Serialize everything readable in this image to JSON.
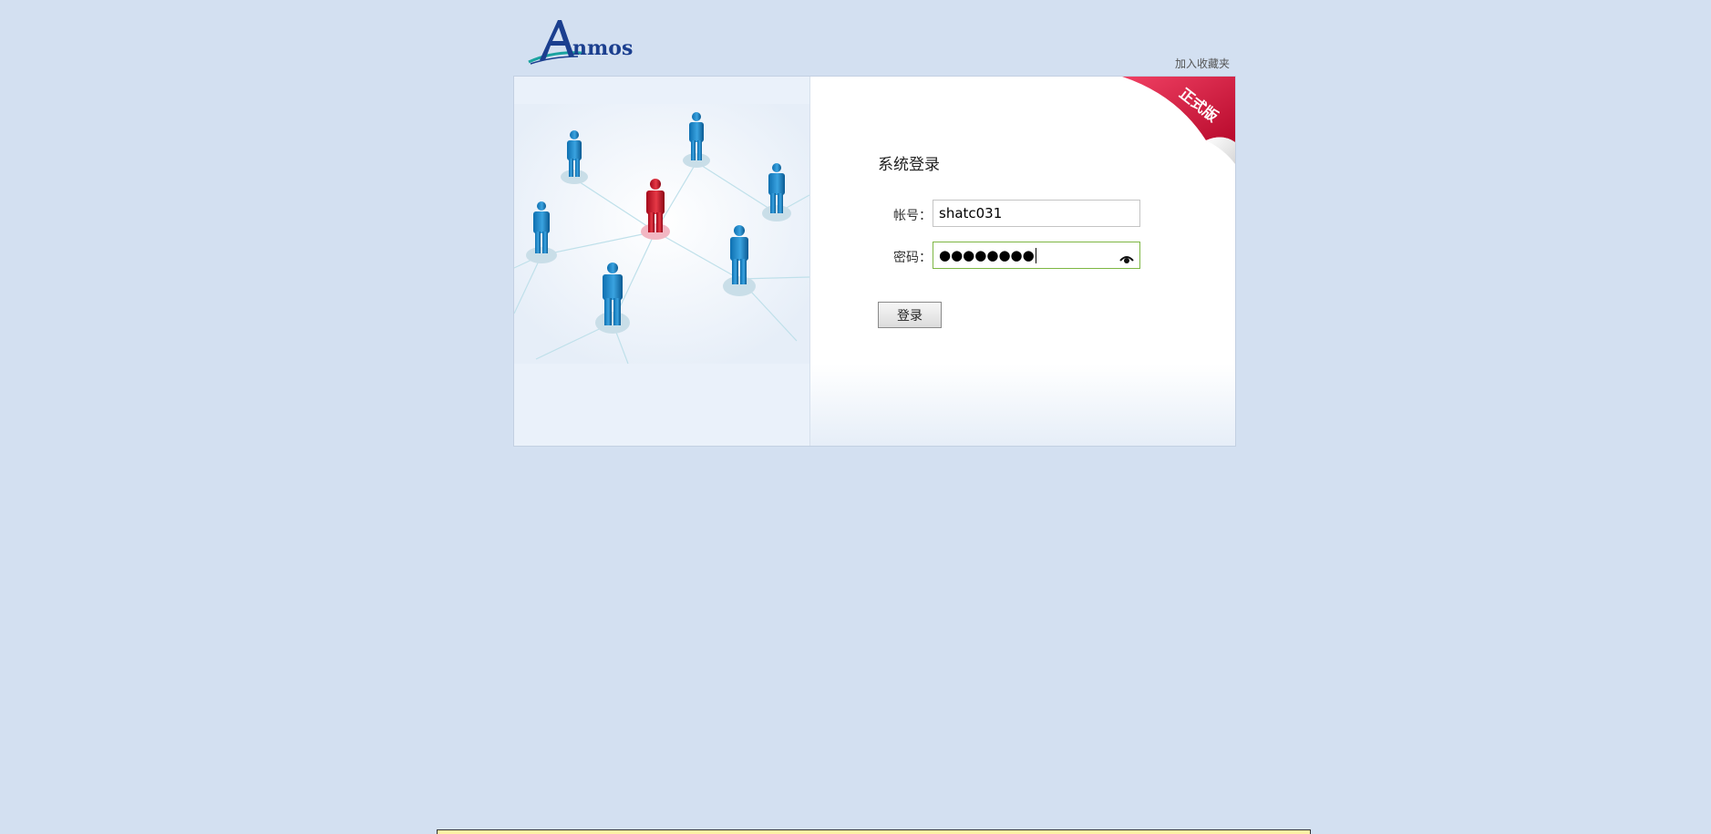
{
  "header": {
    "logo_text": "Annmos",
    "favorite_link": "加入收藏夹"
  },
  "badge": {
    "label": "正式版"
  },
  "login": {
    "title": "系统登录",
    "account_label": "帐号：",
    "account_value": "shatc031",
    "password_label": "密码：",
    "password_masked": "●●●●●●●●",
    "submit_label": "登录"
  },
  "colors": {
    "page_background": "#d3e0f1",
    "badge_red": "#d8123c",
    "focus_border": "#7db643",
    "logo_blue": "#1b3f8f",
    "logo_teal": "#1aa3a0"
  },
  "icons": {
    "logo": "annmos-logo",
    "password_toggle": "eye-icon",
    "illustration": "people-network-illustration"
  }
}
